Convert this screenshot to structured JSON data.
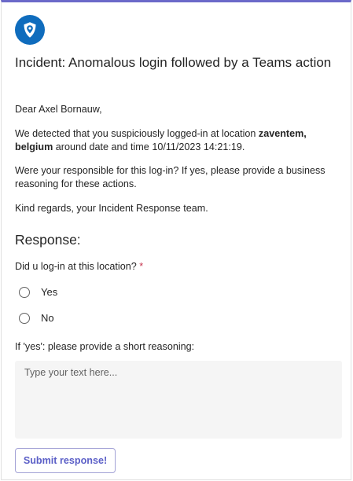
{
  "card": {
    "accent_color": "#6b69c9",
    "logo_icon": "location-shield-icon",
    "logo_color": "#0f6cbd",
    "title": "Incident: Anomalous login followed by a Teams action"
  },
  "message": {
    "greeting": "Dear Axel Bornauw,",
    "detection_prefix": "We detected that you suspiciously logged-in at location ",
    "location": "zaventem, belgium",
    "detection_middle": " around date and time ",
    "datetime": "10/11/2023 14:21:19.",
    "question": "Were your responsible for this log-in? If yes, please provide a business reasoning for these actions.",
    "closing": "Kind regards, your Incident Response team."
  },
  "response": {
    "heading": "Response:",
    "question_label": "Did u log-in at this location?",
    "required_marker": "*",
    "options": [
      "Yes",
      "No"
    ],
    "reasoning_label": "If 'yes': please provide a short reasoning:",
    "reasoning_placeholder": "Type your text here...",
    "submit_label": "Submit response!"
  }
}
